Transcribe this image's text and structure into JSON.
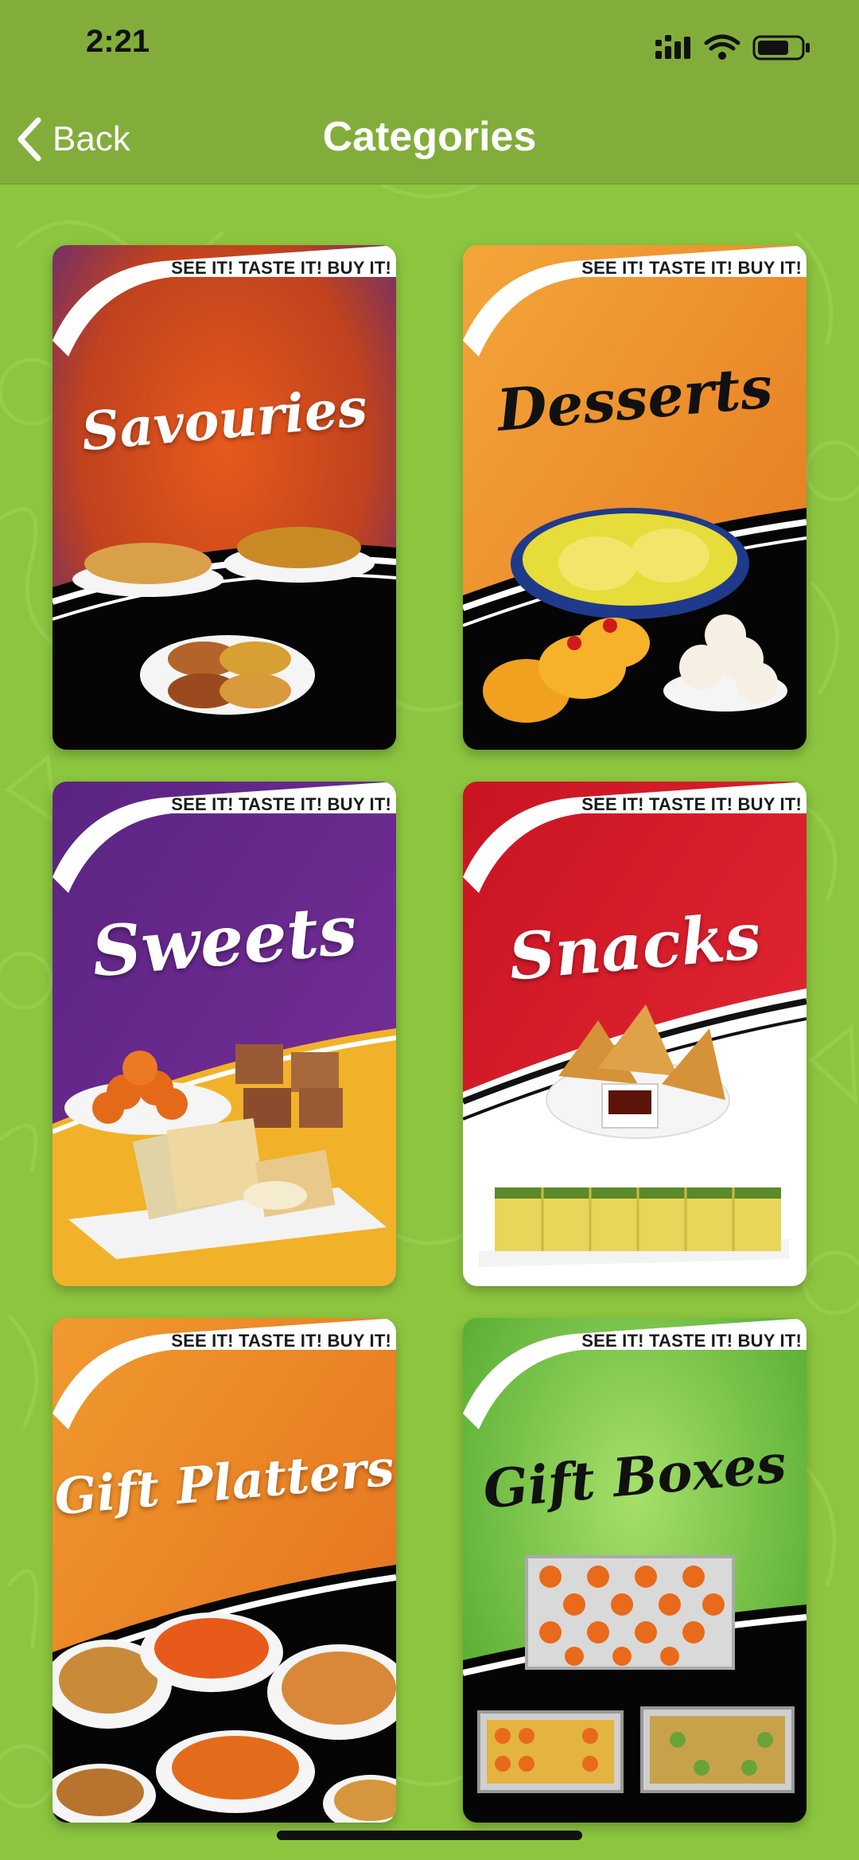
{
  "status_bar": {
    "time": "2:21"
  },
  "nav": {
    "back_label": "Back",
    "title": "Categories"
  },
  "theme": {
    "bar_color": "#82ad3b",
    "background_color": "#8cc63f"
  },
  "categories": [
    {
      "title": "Savouries",
      "tagline": "SEE IT! TASTE IT! BUY IT!",
      "title_color": "#ffffff",
      "top_color": "#d8541f",
      "top_color_dark": "#6a2a7a",
      "bottom_color": "#050505"
    },
    {
      "title": "Desserts",
      "tagline": "SEE IT! TASTE IT! BUY IT!",
      "title_color": "#111111",
      "top_color": "#f0992e",
      "top_color_dark": "#e57a22",
      "bottom_color": "#050505"
    },
    {
      "title": "Sweets",
      "tagline": "SEE IT! TASTE IT! BUY IT!",
      "title_color": "#ffffff",
      "top_color": "#6a2a8e",
      "top_color_dark": "#4c1f74",
      "bottom_color": "#f0b22a"
    },
    {
      "title": "Snacks",
      "tagline": "SEE IT! TASTE IT! BUY IT!",
      "title_color": "#ffffff",
      "top_color": "#de2030",
      "top_color_dark": "#b81422",
      "bottom_color": "#ffffff"
    },
    {
      "title": "Gift Platters",
      "tagline": "SEE IT! TASTE IT! BUY IT!",
      "title_color": "#ffffff",
      "top_color": "#f0902a",
      "top_color_dark": "#e5701e",
      "bottom_color": "#050505"
    },
    {
      "title": "Gift Boxes",
      "tagline": "SEE IT! TASTE IT! BUY IT!",
      "title_color": "#111111",
      "top_color": "#8ad04a",
      "top_color_dark": "#5fb133",
      "bottom_color": "#050505"
    }
  ]
}
